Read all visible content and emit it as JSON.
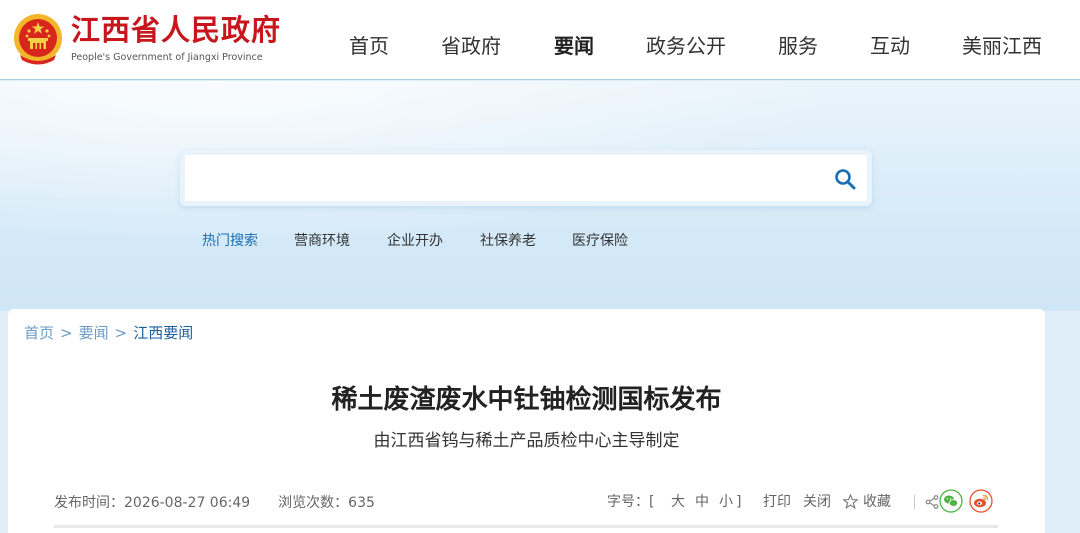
{
  "header": {
    "site_name_cn": "江西省人民政府",
    "site_name_en": "People's Government of Jiangxi Province",
    "nav": [
      "首页",
      "省政府",
      "要闻",
      "政务公开",
      "服务",
      "互动",
      "美丽江西"
    ],
    "active_nav": "要闻",
    "brand_color": "#c8161d"
  },
  "search": {
    "value": "",
    "hot_label": "热门搜索",
    "hot_terms": [
      "营商环境",
      "企业开办",
      "社保养老",
      "医疗保险"
    ]
  },
  "breadcrumb": {
    "items": [
      "首页",
      "要闻",
      "江西要闻"
    ],
    "separator": ">"
  },
  "article": {
    "title": "稀土废渣废水中钍铀检测国标发布",
    "subtitle": "由江西省钨与稀土产品质检中心主导制定",
    "publish_label": "发布时间：",
    "publish_time": "2026-08-27 06:49",
    "views_label": "浏览次数：",
    "views": "635"
  },
  "tools": {
    "font_size_label": "字号：[",
    "font_large": "大",
    "font_medium": "中",
    "font_small": "小",
    "font_close": "]",
    "print": "打印",
    "close": "关闭",
    "favorite": "收藏",
    "icons": [
      "share-icon",
      "wechat-icon",
      "weibo-icon"
    ]
  }
}
